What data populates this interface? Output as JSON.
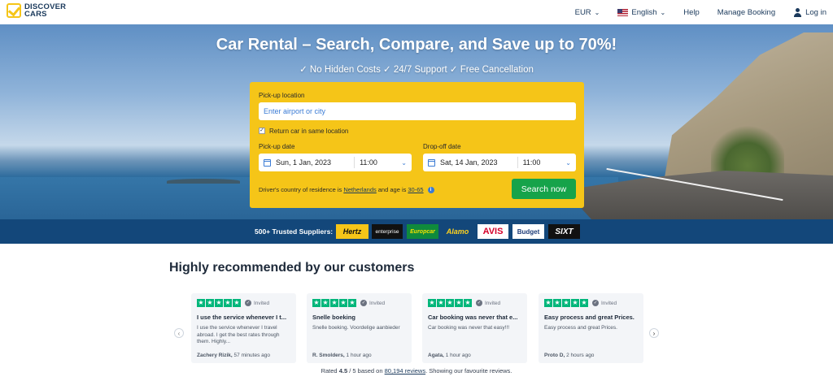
{
  "header": {
    "logo_line1": "DISCOVER",
    "logo_line2": "CARS",
    "currency": "EUR",
    "language": "English",
    "help": "Help",
    "manage_booking": "Manage Booking",
    "login": "Log in"
  },
  "hero": {
    "title": "Car Rental – Search, Compare, and Save up to 70%!",
    "subtitle": "✓ No Hidden Costs ✓ 24/7 Support ✓ Free Cancellation"
  },
  "search": {
    "pickup_label": "Pick-up location",
    "pickup_placeholder": "Enter airport or city",
    "return_same_label": "Return car in same location",
    "return_same_checked": true,
    "pickup_date_label": "Pick-up date",
    "pickup_date": "Sun, 1 Jan, 2023",
    "pickup_time": "11:00",
    "dropoff_date_label": "Drop-off date",
    "dropoff_date": "Sat, 14 Jan, 2023",
    "dropoff_time": "11:00",
    "residence_prefix": "Driver's country of residence is",
    "residence_country": "Netherlands",
    "age_prefix": "and age is",
    "age_range": "30-65",
    "search_button": "Search now"
  },
  "suppliers": {
    "label": "500+ Trusted Suppliers:",
    "logos": [
      "Hertz",
      "enterprise",
      "Europcar",
      "Alamo",
      "AVIS",
      "Budget",
      "SIXT"
    ]
  },
  "reviews": {
    "title": "Highly recommended by our customers",
    "invited_label": "Invited",
    "star_color": "#00b67a",
    "cards": [
      {
        "title": "I use the service whenever I t...",
        "body": "I use the service whenever I travel abroad. I get the best rates through them. Highly...",
        "author": "Zachery Rizik,",
        "time": "57 minutes ago"
      },
      {
        "title": "Snelle boeking",
        "body": "Snelle boeking. Voordelige aanbieder",
        "author": "R. Smolders,",
        "time": "1 hour ago"
      },
      {
        "title": "Car booking was never that e...",
        "body": "Car booking was never that easy!!!",
        "author": "Agata,",
        "time": "1 hour ago"
      },
      {
        "title": "Easy process and great Prices.",
        "body": "Easy process and great Prices.",
        "author": "Proto D,",
        "time": "2 hours ago"
      }
    ],
    "rated_prefix": "Rated",
    "rating": "4.5",
    "rating_suffix": "/ 5 based on",
    "reviews_count": "80,194 reviews",
    "rated_tail": ". Showing our favourite reviews."
  },
  "colors": {
    "brand_yellow": "#f5c518",
    "cta_green": "#16a34a",
    "suppliers_bar": "#13477a"
  }
}
